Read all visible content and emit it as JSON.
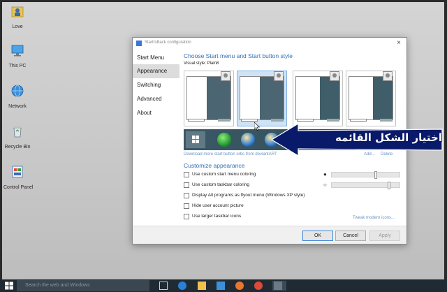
{
  "desktop": {
    "icons": [
      {
        "label": "Love",
        "icon": "user-folder-icon"
      },
      {
        "label": "This PC",
        "icon": "computer-icon"
      },
      {
        "label": "Network",
        "icon": "network-icon"
      },
      {
        "label": "Recycle Bin",
        "icon": "recycle-bin-icon"
      },
      {
        "label": "Control Panel",
        "icon": "control-panel-icon"
      }
    ]
  },
  "window": {
    "title": "StartIsBack configuration",
    "close_glyph": "×",
    "sidebar": {
      "items": [
        {
          "label": "Start Menu",
          "active": false
        },
        {
          "label": "Appearance",
          "active": true
        },
        {
          "label": "Switching",
          "active": false
        },
        {
          "label": "Advanced",
          "active": false
        },
        {
          "label": "About",
          "active": false
        }
      ]
    },
    "style_section": {
      "heading": "Choose Start menu and Start button style",
      "visual_style": "Visual style: Plain8",
      "selected_thumb": 1,
      "download_link": "Download more start button orbs from deviantART",
      "add_link": "Add...",
      "delete_link": "Delete",
      "orbs": [
        "windows10-logo-icon",
        "green-orb-icon",
        "windows7-orb-icon",
        "windows7-orb-icon"
      ]
    },
    "customize": {
      "heading": "Customize appearance",
      "options": [
        {
          "label": "Use custom start menu coloring",
          "checked": false
        },
        {
          "label": "Use custom taskbar coloring",
          "checked": false
        },
        {
          "label": "Display All programs as flyout menu (Windows XP style)",
          "checked": false
        },
        {
          "label": "Hide user account picture",
          "checked": false
        },
        {
          "label": "Use larger taskbar icons",
          "checked": false
        }
      ],
      "tweak_link": "Tweak modern icons...",
      "sliders": [
        {
          "icon": "drop-filled-icon",
          "glyph": "●",
          "level": 0.66
        },
        {
          "icon": "drop-outline-icon",
          "glyph": "○",
          "level": 0.86
        }
      ]
    },
    "buttons": {
      "ok": "OK",
      "cancel": "Cancel",
      "apply": "Apply"
    }
  },
  "annotation": {
    "text": "اختيار الشكل القائمه",
    "color": "#0a1a6a"
  },
  "taskbar": {
    "search_placeholder": "Search the web and Windows",
    "apps": [
      "task-view-icon",
      "edge-icon",
      "file-explorer-icon",
      "store-icon",
      "firefox-icon",
      "chrome-icon",
      "media-icon",
      "app-icon"
    ]
  },
  "colors": {
    "accent": "#2f6fb5",
    "link": "#6a94c4",
    "selected_thumb": "#cfe3f7",
    "taskbar": "#1f2a33"
  }
}
